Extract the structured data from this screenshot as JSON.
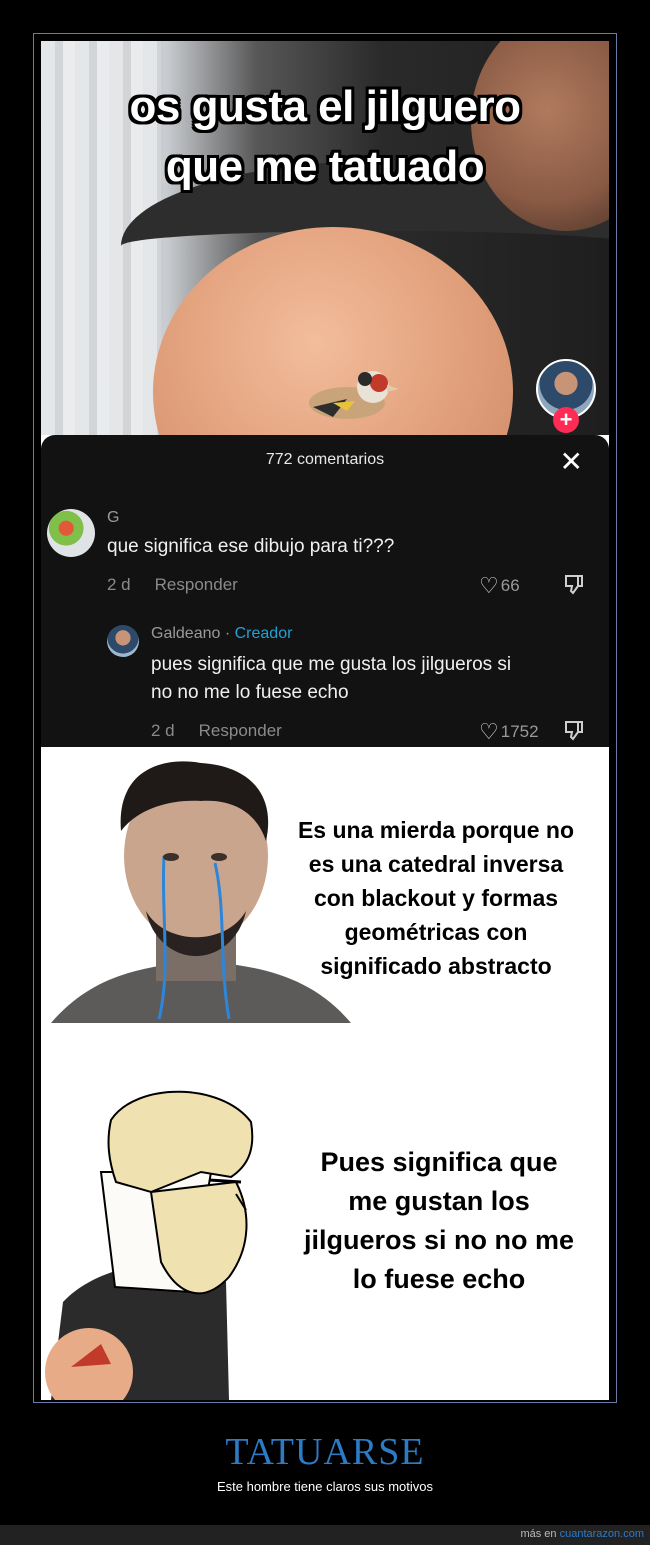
{
  "video": {
    "caption_line1": "os gusta el jilguero",
    "caption_line2": "que me tatuado",
    "follow_symbol": "+"
  },
  "comments_panel": {
    "count_label": "772 comentarios",
    "close_symbol": "✕",
    "comments": [
      {
        "username": "G",
        "text": "que significa ese dibujo para ti???",
        "age": "2 d",
        "reply_label": "Responder",
        "likes": "66"
      },
      {
        "username": "Galdeano",
        "separator": " · ",
        "creator_badge": "Creador",
        "text_line1": "pues significa que me gusta los jilgueros si",
        "text_line2": "no no me lo fuese echo",
        "age": "2 d",
        "reply_label": "Responder",
        "likes": "1752"
      }
    ]
  },
  "meme": {
    "top_text": [
      "Es una mierda porque no",
      "es una catedral inversa",
      "con blackout y formas",
      "geométricas con",
      "significado abstracto"
    ],
    "bottom_text": [
      "Pues significa que",
      "me gustan los",
      "jilgueros si no no me",
      "lo fuese echo"
    ]
  },
  "post": {
    "title": "TATUARSE",
    "subtitle": "Este hombre tiene claros sus motivos",
    "credit_prefix": "más en ",
    "credit_site": "cuantarazon.com"
  },
  "colors": {
    "accent_blue": "#2c7bc5",
    "creator_blue": "#1fa1d6",
    "follow_red": "#fe2c55",
    "panel_dark": "#121212"
  },
  "icons": [
    "heart-icon",
    "dislike-icon",
    "close-icon",
    "plus-icon"
  ]
}
